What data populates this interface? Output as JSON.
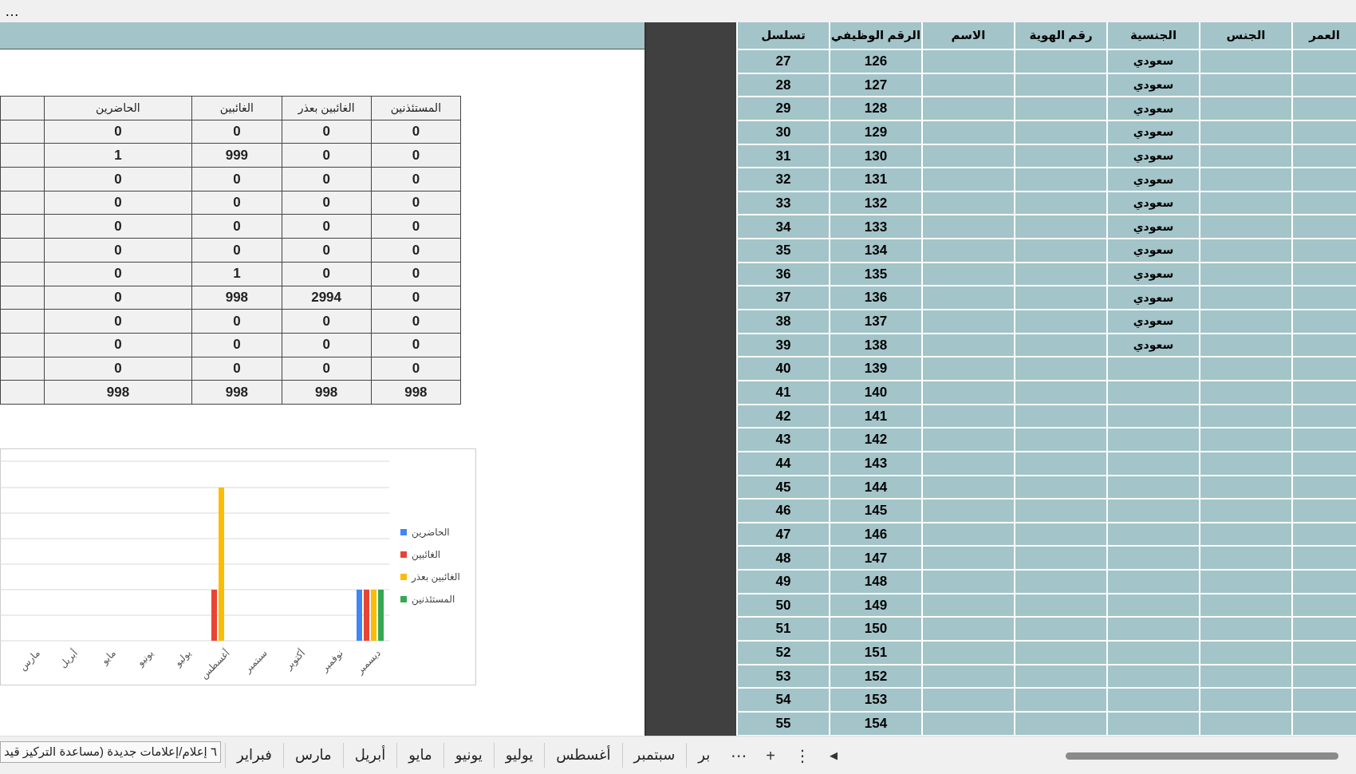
{
  "toolbar": {
    "more": "…"
  },
  "summary_table": {
    "columns": [
      "المستئذنين",
      "الغائبين بعذر",
      "الغائبين",
      "الحاضرين"
    ],
    "rows": [
      [
        "0",
        "0",
        "0",
        "0"
      ],
      [
        "0",
        "0",
        "999",
        "1"
      ],
      [
        "0",
        "0",
        "0",
        "0"
      ],
      [
        "0",
        "0",
        "0",
        "0"
      ],
      [
        "0",
        "0",
        "0",
        "0"
      ],
      [
        "0",
        "0",
        "0",
        "0"
      ],
      [
        "0",
        "0",
        "1",
        "0"
      ],
      [
        "0",
        "2994",
        "998",
        "0"
      ],
      [
        "0",
        "0",
        "0",
        "0"
      ],
      [
        "0",
        "0",
        "0",
        "0"
      ],
      [
        "0",
        "0",
        "0",
        "0"
      ],
      [
        "998",
        "998",
        "998",
        "998"
      ]
    ]
  },
  "chart": {
    "kind": "picture",
    "legend": [
      {
        "label": "الحاضرين",
        "color": "#4285f4"
      },
      {
        "label": "الغائبين",
        "color": "#ea4335"
      },
      {
        "label": "الغائبين بعذر",
        "color": "#fbbc04"
      },
      {
        "label": "المستئذنين",
        "color": "#34a853"
      }
    ],
    "x_labels": [
      "مارس",
      "أبريل",
      "مايو",
      "يونيو",
      "يوليو",
      "أغسطس",
      "سبتمبر",
      "أكتوبر",
      "نوفمبر",
      "ديسمبر"
    ]
  },
  "employee_table": {
    "columns": [
      "العمر",
      "الجنس",
      "الجنسية",
      "رقم الهوية",
      "الاسم",
      "الرقم الوظيفي",
      "تسلسل"
    ],
    "rows": [
      {
        "seq": "27",
        "job_no": "126",
        "nationality": "سعودي"
      },
      {
        "seq": "28",
        "job_no": "127",
        "nationality": "سعودي"
      },
      {
        "seq": "29",
        "job_no": "128",
        "nationality": "سعودي"
      },
      {
        "seq": "30",
        "job_no": "129",
        "nationality": "سعودي"
      },
      {
        "seq": "31",
        "job_no": "130",
        "nationality": "سعودي"
      },
      {
        "seq": "32",
        "job_no": "131",
        "nationality": "سعودي"
      },
      {
        "seq": "33",
        "job_no": "132",
        "nationality": "سعودي"
      },
      {
        "seq": "34",
        "job_no": "133",
        "nationality": "سعودي"
      },
      {
        "seq": "35",
        "job_no": "134",
        "nationality": "سعودي"
      },
      {
        "seq": "36",
        "job_no": "135",
        "nationality": "سعودي"
      },
      {
        "seq": "37",
        "job_no": "136",
        "nationality": "سعودي"
      },
      {
        "seq": "38",
        "job_no": "137",
        "nationality": "سعودي"
      },
      {
        "seq": "39",
        "job_no": "138",
        "nationality": "سعودي"
      },
      {
        "seq": "40",
        "job_no": "139"
      },
      {
        "seq": "41",
        "job_no": "140"
      },
      {
        "seq": "42",
        "job_no": "141"
      },
      {
        "seq": "43",
        "job_no": "142"
      },
      {
        "seq": "44",
        "job_no": "143"
      },
      {
        "seq": "45",
        "job_no": "144"
      },
      {
        "seq": "46",
        "job_no": "145"
      },
      {
        "seq": "47",
        "job_no": "146"
      },
      {
        "seq": "48",
        "job_no": "147"
      },
      {
        "seq": "49",
        "job_no": "148"
      },
      {
        "seq": "50",
        "job_no": "149"
      },
      {
        "seq": "51",
        "job_no": "150"
      },
      {
        "seq": "52",
        "job_no": "151"
      },
      {
        "seq": "53",
        "job_no": "152"
      },
      {
        "seq": "54",
        "job_no": "153"
      },
      {
        "seq": "55",
        "job_no": "154"
      }
    ]
  },
  "notification": {
    "text": "٦ إعلام/إعلامات جديدة (مساعدة التركيز قيد"
  },
  "sheet_tabs": [
    "بر",
    "سبتمبر",
    "أغسطس",
    "يوليو",
    "يونيو",
    "مايو",
    "أبريل",
    "مارس",
    "فبراير"
  ],
  "tab_bar": {
    "more": "⋯",
    "add": "+",
    "options": "⋮",
    "scroll_left": "◀"
  }
}
